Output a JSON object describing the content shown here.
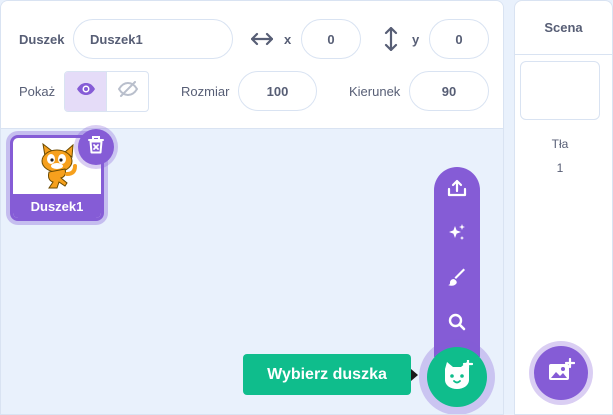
{
  "sprite_info": {
    "sprite_label": "Duszek",
    "sprite_name": "Duszek1",
    "x_label": "x",
    "x_value": "0",
    "y_label": "y",
    "y_value": "0",
    "show_label": "Pokaż",
    "size_label": "Rozmiar",
    "size_value": "100",
    "direction_label": "Kierunek",
    "direction_value": "90",
    "visible": true
  },
  "sprites": [
    {
      "name": "Duszek1",
      "selected": true
    }
  ],
  "sprite_menu": {
    "items": [
      "upload-icon",
      "surprise-icon",
      "paint-icon",
      "search-icon"
    ],
    "tooltip": "Wybierz duszka"
  },
  "stage": {
    "header": "Scena",
    "backdrops_label": "Tła",
    "backdrops_count": "1"
  },
  "colors": {
    "accent": "#855cd6",
    "green": "#0fbd8c",
    "background": "#e9f1fc",
    "text": "#575e75"
  }
}
